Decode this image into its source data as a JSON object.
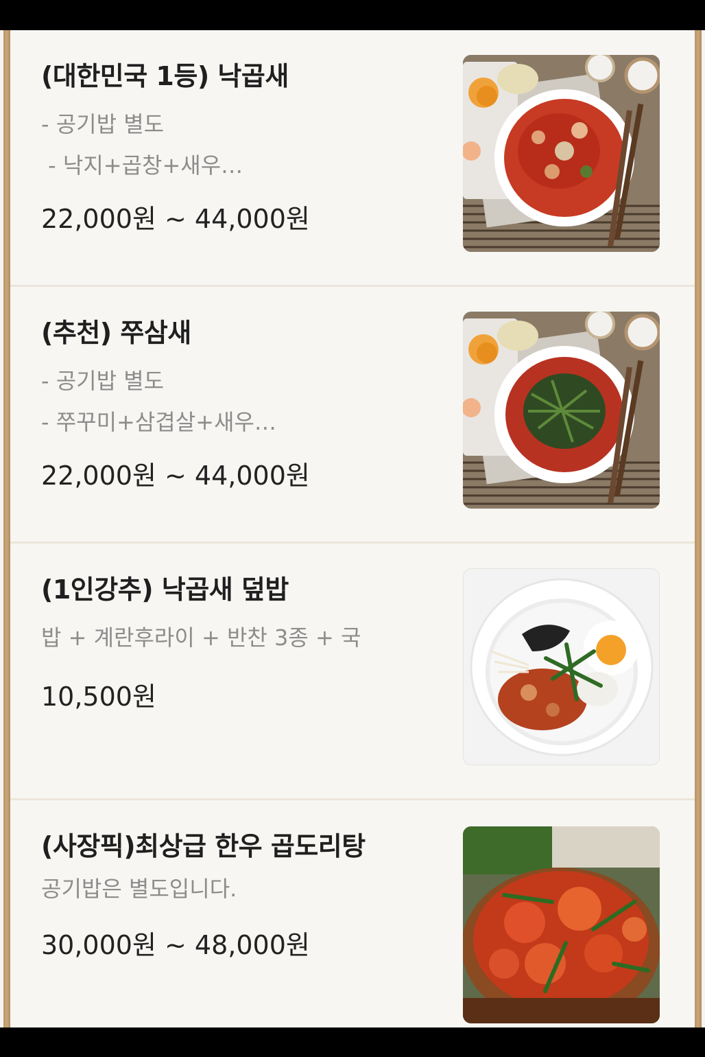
{
  "menu": {
    "items": [
      {
        "title": "(대한민국 1등) 낙곱새",
        "desc_lines": [
          "- 공기밥 별도",
          " - 낙지+곱창+새우…"
        ],
        "price": "22,000원 ~ 44,000원",
        "image_icon": "nakgopsae-dish-photo"
      },
      {
        "title": "(추천) 쭈삼새",
        "desc_lines": [
          "- 공기밥 별도",
          "- 쭈꾸미+삼겹살+새우…"
        ],
        "price": "22,000원 ~ 44,000원",
        "image_icon": "jjusamsae-dish-photo"
      },
      {
        "title": "(1인강추) 낙곱새 덮밥",
        "desc_lines": [
          "밥 + 계란후라이 + 반찬 3종 + 국"
        ],
        "price": "10,500원",
        "image_icon": "rice-bowl-dish-photo"
      },
      {
        "title": "(사장픽)최상급 한우 곱도리탕",
        "desc_lines": [
          "공기밥은 별도입니다."
        ],
        "price": "30,000원 ~ 48,000원",
        "image_icon": "gopdoritang-dish-photo"
      }
    ]
  }
}
